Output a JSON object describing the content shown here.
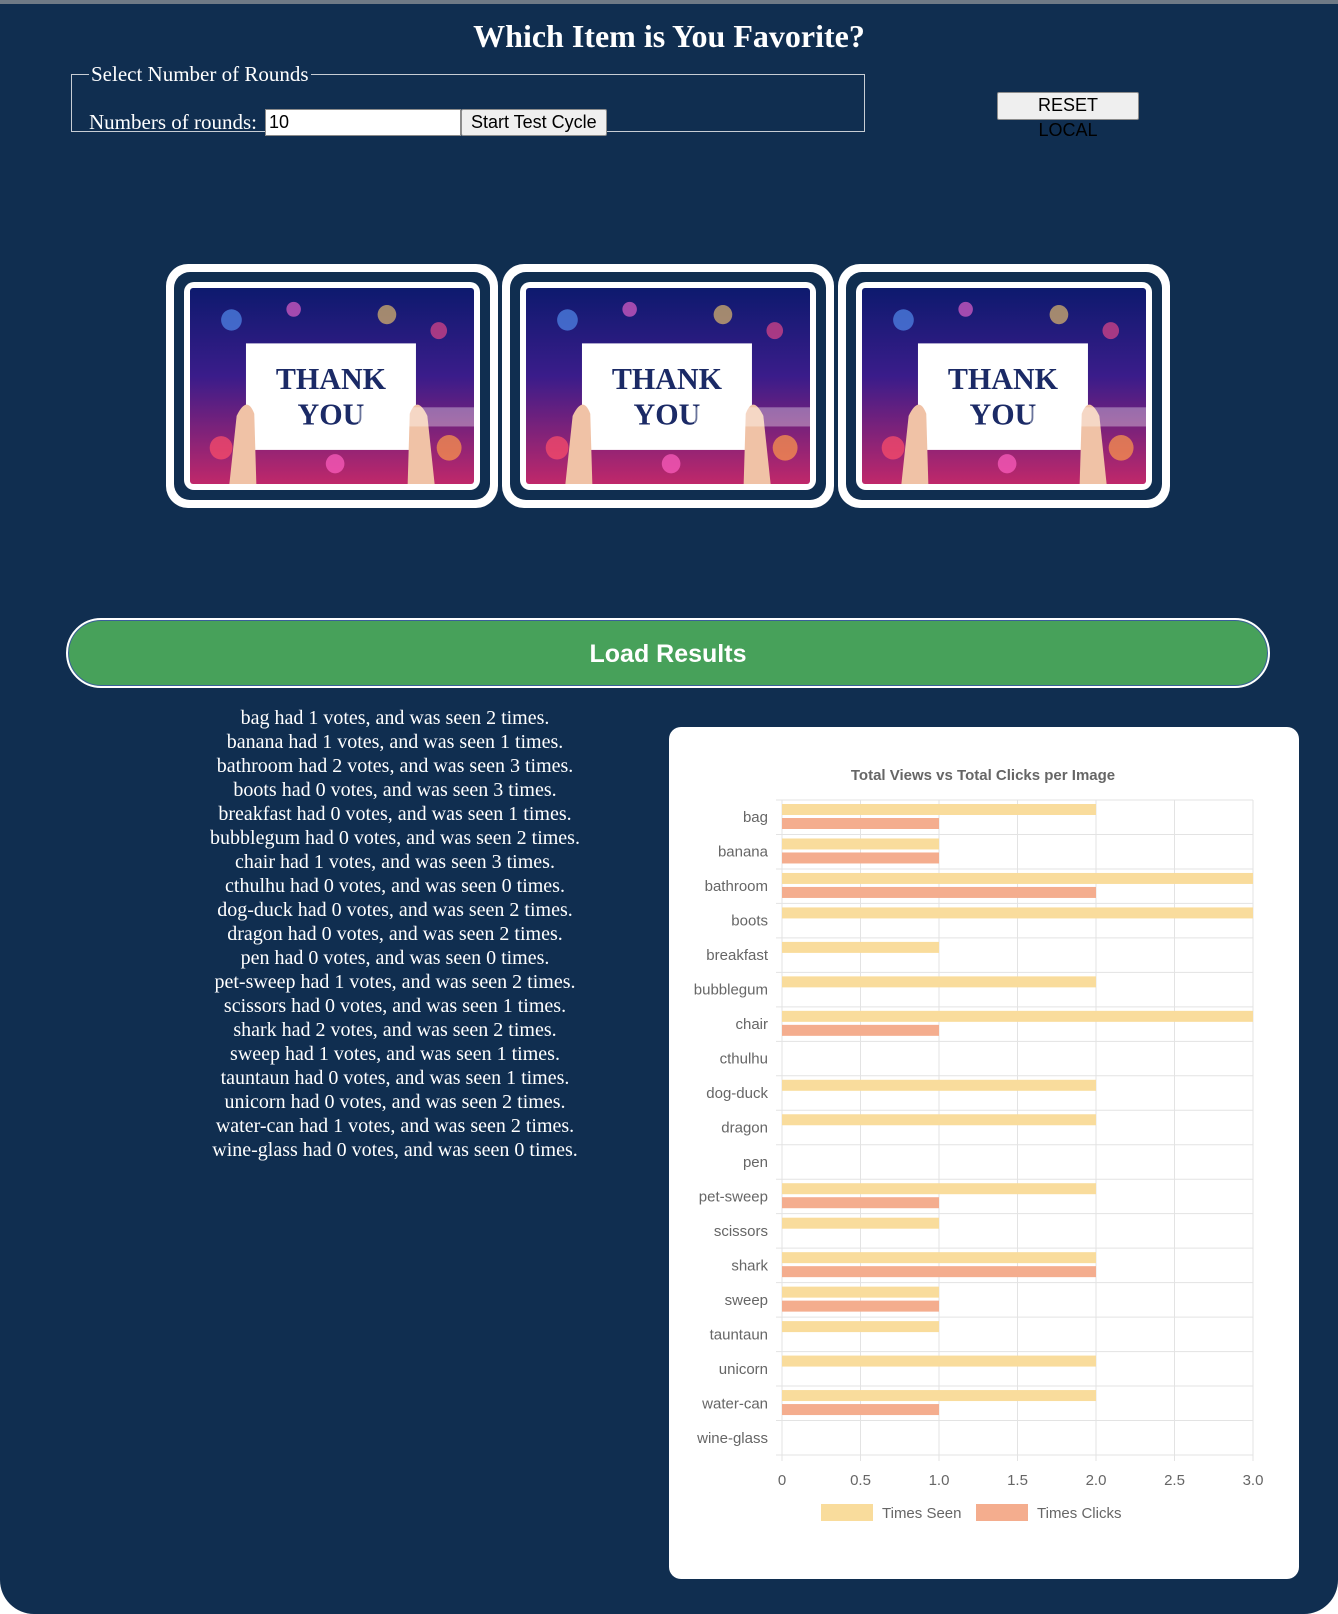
{
  "header": {
    "title": "Which Item is You Favorite?"
  },
  "rounds_form": {
    "legend": "Select Number of Rounds",
    "label": "Numbers of rounds:",
    "value": "10",
    "start_button": "Start Test Cycle"
  },
  "reset_button": "RESET LOCAL",
  "images": [
    {
      "caption": "THANK",
      "caption2": "YOU"
    },
    {
      "caption": "THANK",
      "caption2": "YOU"
    },
    {
      "caption": "THANK",
      "caption2": "YOU"
    }
  ],
  "load_button": "Load Results",
  "results": [
    "bag had 1 votes, and was seen 2 times.",
    "banana had 1 votes, and was seen 1 times.",
    "bathroom had 2 votes, and was seen 3 times.",
    "boots had 0 votes, and was seen 3 times.",
    "breakfast had 0 votes, and was seen 1 times.",
    "bubblegum had 0 votes, and was seen 2 times.",
    "chair had 1 votes, and was seen 3 times.",
    "cthulhu had 0 votes, and was seen 0 times.",
    "dog-duck had 0 votes, and was seen 2 times.",
    "dragon had 0 votes, and was seen 2 times.",
    "pen had 0 votes, and was seen 0 times.",
    "pet-sweep had 1 votes, and was seen 2 times.",
    "scissors had 0 votes, and was seen 1 times.",
    "shark had 2 votes, and was seen 2 times.",
    "sweep had 1 votes, and was seen 1 times.",
    "tauntaun had 0 votes, and was seen 1 times.",
    "unicorn had 0 votes, and was seen 2 times.",
    "water-can had 1 votes, and was seen 2 times.",
    "wine-glass had 0 votes, and was seen 0 times."
  ],
  "colors": {
    "page_bg": "#102e50",
    "load_button": "#47a15a",
    "times_seen": "#f9dc9c",
    "times_clicks": "#f4ad8e"
  },
  "chart_data": {
    "type": "bar",
    "orientation": "horizontal",
    "title": "Total Views vs Total Clicks per Image",
    "categories": [
      "bag",
      "banana",
      "bathroom",
      "boots",
      "breakfast",
      "bubblegum",
      "chair",
      "cthulhu",
      "dog-duck",
      "dragon",
      "pen",
      "pet-sweep",
      "scissors",
      "shark",
      "sweep",
      "tauntaun",
      "unicorn",
      "water-can",
      "wine-glass"
    ],
    "series": [
      {
        "name": "Times Seen",
        "color": "#f9dc9c",
        "values": [
          2,
          1,
          3,
          3,
          1,
          2,
          3,
          0,
          2,
          2,
          0,
          2,
          1,
          2,
          1,
          1,
          2,
          2,
          0
        ]
      },
      {
        "name": "Times Clicks",
        "color": "#f4ad8e",
        "values": [
          1,
          1,
          2,
          0,
          0,
          0,
          1,
          0,
          0,
          0,
          0,
          1,
          0,
          2,
          1,
          0,
          0,
          1,
          0
        ]
      }
    ],
    "xlim": [
      0,
      3
    ],
    "xticks": [
      "0",
      "0.5",
      "1.0",
      "1.5",
      "2.0",
      "2.5",
      "3.0"
    ],
    "grid": true,
    "legend_position": "bottom"
  }
}
